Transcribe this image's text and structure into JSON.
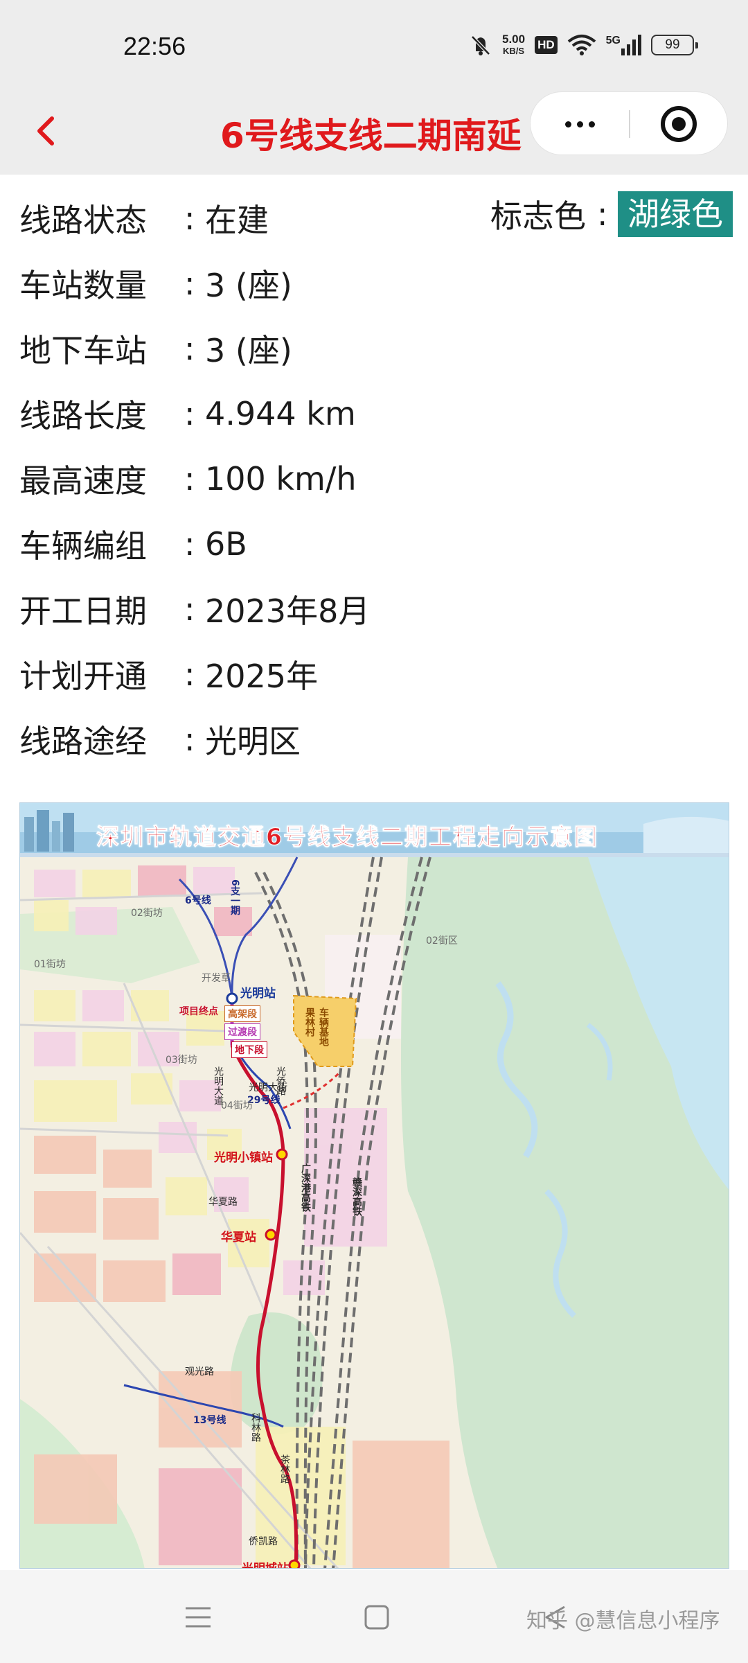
{
  "status_bar": {
    "time": "22:56",
    "speed_value": "5.00",
    "speed_unit": "KB/S",
    "hd": "HD",
    "network": "5G",
    "battery": "99",
    "icons": [
      "mute-icon",
      "wifi-icon",
      "signal-icon",
      "battery-icon"
    ]
  },
  "nav": {
    "title": "6号线支线二期南延",
    "icons": [
      "back-icon",
      "more-icon",
      "close-miniprogram-icon"
    ]
  },
  "info": {
    "separator": ":",
    "color_label": "标志色",
    "color_value": "湖绿色",
    "color_hex": "#1f8f86",
    "rows": [
      {
        "label": "线路状态",
        "value": "在建"
      },
      {
        "label": "车站数量",
        "value": "3 (座)"
      },
      {
        "label": "地下车站",
        "value": "3 (座)"
      },
      {
        "label": "线路长度",
        "value": "4.944 km"
      },
      {
        "label": "最高速度",
        "value": "100 km/h"
      },
      {
        "label": "车辆编组",
        "value": "6B"
      },
      {
        "label": "开工日期",
        "value": "2023年8月"
      },
      {
        "label": "计划开通",
        "value": "2025年"
      },
      {
        "label": "线路途经",
        "value": "光明区"
      }
    ]
  },
  "map": {
    "title": "深圳市轨道交通6号线支线二期工程走向示意图",
    "stations": [
      "光明站",
      "光明小镇站",
      "华夏站",
      "光明城站"
    ],
    "segments": [
      "高架段",
      "过渡段",
      "地下段"
    ],
    "depot": [
      "果林村",
      "车辆基地"
    ],
    "project_start": "项目终点",
    "lines": [
      "6号线",
      "6支一期",
      "29号线",
      "13号线"
    ],
    "roads": [
      "光明大道",
      "光明大街",
      "光侨路",
      "华夏路",
      "科林路",
      "茶林路",
      "观光路",
      "侨凯路"
    ],
    "railways": [
      "广深港高铁",
      "赣深高铁"
    ],
    "zones": [
      "02街坊",
      "01街坊",
      "03街坊",
      "04街坊",
      "02街区"
    ],
    "misc": [
      "开发草"
    ]
  },
  "bottom": {
    "watermark": "知乎 @慧信息小程序",
    "icons": [
      "menu-icon",
      "home-icon",
      "back-triangle-icon"
    ]
  }
}
